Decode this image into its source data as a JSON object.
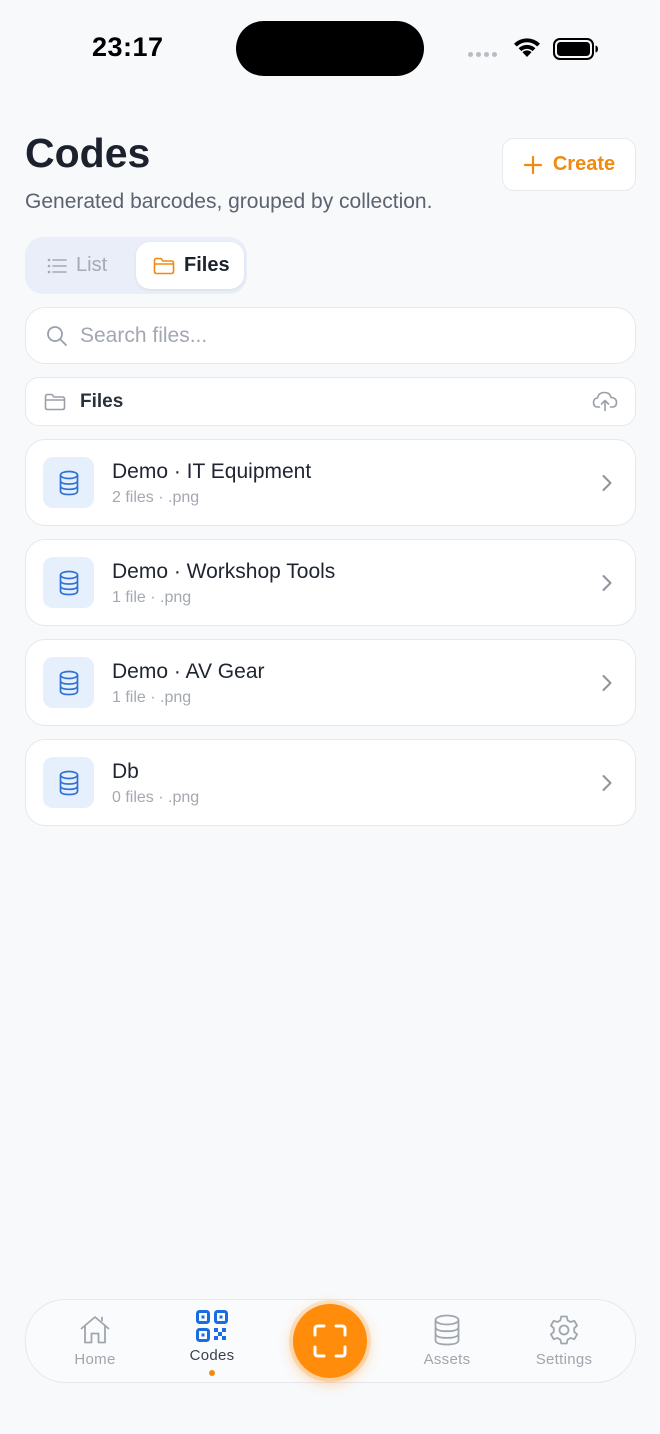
{
  "status_bar": {
    "time": "23:17"
  },
  "header": {
    "title": "Codes",
    "subtitle": "Generated barcodes, grouped by collection.",
    "create_label": "Create"
  },
  "view_toggle": {
    "options": [
      {
        "label": "List",
        "icon": "list-icon",
        "selected": false
      },
      {
        "label": "Files",
        "icon": "folder-icon",
        "selected": true
      }
    ]
  },
  "search": {
    "placeholder": "Search files...",
    "value": ""
  },
  "files_section": {
    "label": "Files",
    "action_icon": "cloud-upload-icon"
  },
  "collections": [
    {
      "title": "Demo · IT Equipment",
      "meta": "2 files · .png",
      "icon": "database-icon"
    },
    {
      "title": "Demo · Workshop Tools",
      "meta": "1 file · .png",
      "icon": "database-icon"
    },
    {
      "title": "Demo · AV Gear",
      "meta": "1 file · .png",
      "icon": "database-icon"
    },
    {
      "title": "Db",
      "meta": "0 files · .png",
      "icon": "database-icon"
    }
  ],
  "tab_bar": {
    "tabs": [
      {
        "label": "Home",
        "icon": "home-icon",
        "active": false
      },
      {
        "label": "Codes",
        "icon": "qr-code-icon",
        "active": true
      },
      {
        "label": "Assets",
        "icon": "database-icon",
        "active": false
      },
      {
        "label": "Settings",
        "icon": "gear-icon",
        "active": false
      }
    ],
    "center_action_icon": "scan-icon"
  },
  "colors": {
    "accent": "#f28a10",
    "scan_button": "#ff8c0a",
    "icon_blue": "#2f72d6",
    "badge_bg": "#e6effc",
    "background": "#f8f9fb"
  }
}
